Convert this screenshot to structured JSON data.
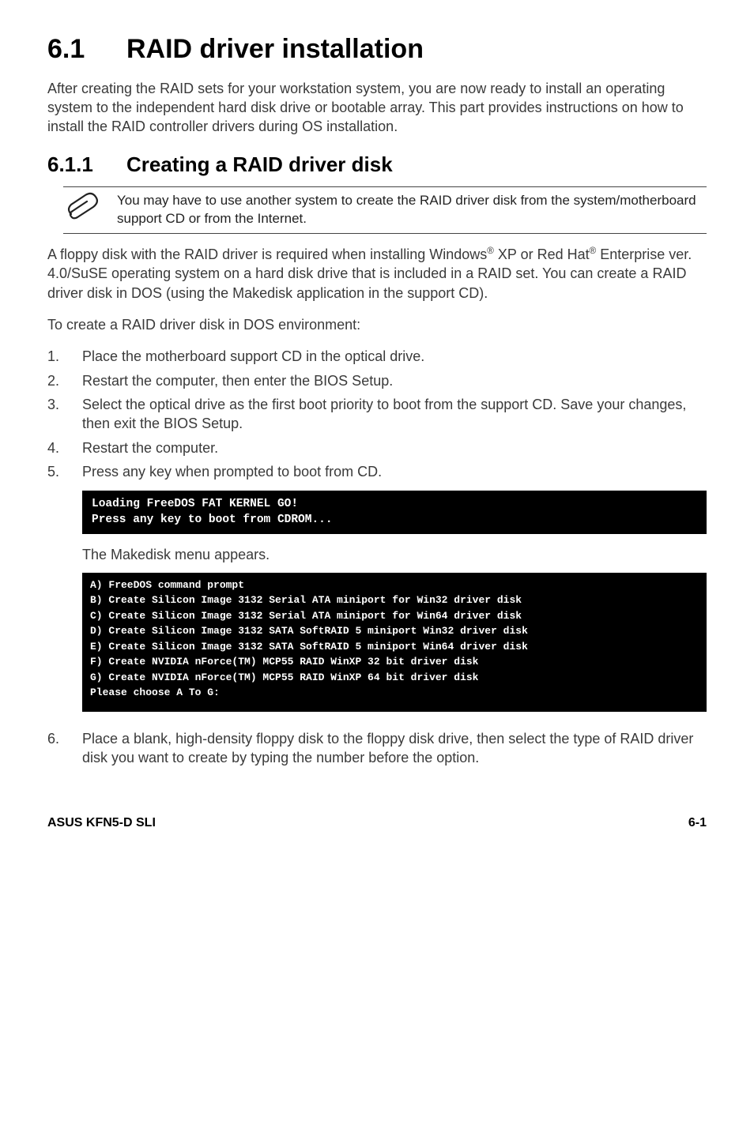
{
  "heading": {
    "num": "6.1",
    "title": "RAID driver installation"
  },
  "intro": "After creating the RAID sets for your workstation system, you are now ready to install an operating system to the independent hard disk drive or bootable array. This part provides instructions on how to install the RAID controller drivers during OS installation.",
  "subheading": {
    "num": "6.1.1",
    "title": "Creating a RAID driver disk"
  },
  "note": "You may have to use another system to create the RAID driver disk from the system/motherboard support CD or from the Internet.",
  "para1_pre": "A floppy disk with the RAID driver is required when installing Windows",
  "para1_mid": " XP or Red Hat",
  "para1_post": " Enterprise ver. 4.0/SuSE operating system on a hard disk drive that is included in a RAID set. You can create a RAID driver disk in DOS (using the Makedisk application in the support CD).",
  "para2": "To create a RAID driver disk in DOS environment:",
  "steps1": [
    "Place the motherboard support CD in the optical drive.",
    "Restart the computer, then enter the BIOS Setup.",
    "Select the optical drive as the first boot priority to boot from the support CD. Save your changes, then exit the BIOS Setup.",
    "Restart the computer.",
    "Press any key when prompted to boot from CD."
  ],
  "term1": "Loading FreeDOS FAT KERNEL GO!\nPress any key to boot from CDROM...",
  "appears": "The Makedisk menu appears.",
  "term2": "A) FreeDOS command prompt\nB) Create Silicon Image 3132 Serial ATA miniport for Win32 driver disk\nC) Create Silicon Image 3132 Serial ATA miniport for Win64 driver disk\nD) Create Silicon Image 3132 SATA SoftRAID 5 miniport Win32 driver disk\nE) Create Silicon Image 3132 SATA SoftRAID 5 miniport Win64 driver disk\nF) Create NVIDIA nForce(TM) MCP55 RAID WinXP 32 bit driver disk\nG) Create NVIDIA nForce(TM) MCP55 RAID WinXP 64 bit driver disk\nPlease choose A To G:",
  "step6": {
    "num": "6.",
    "text": "Place a blank, high-density floppy disk to the floppy disk drive, then select the type of RAID driver disk you want to create by typing the number before the option."
  },
  "footer": {
    "left": "ASUS KFN5-D SLI",
    "right": "6-1"
  }
}
